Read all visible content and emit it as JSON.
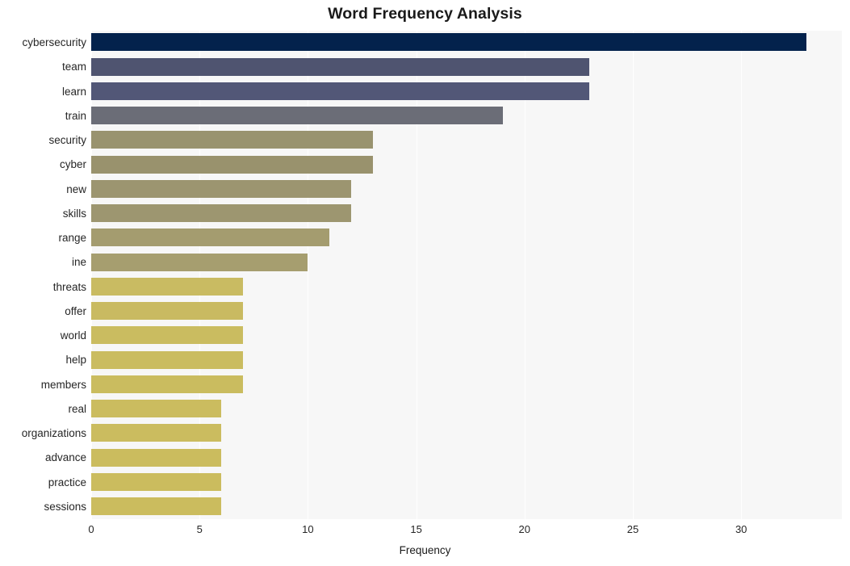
{
  "chart_data": {
    "type": "bar",
    "orientation": "horizontal",
    "title": "Word Frequency Analysis",
    "xlabel": "Frequency",
    "ylabel": "",
    "xlim": [
      0,
      34.65
    ],
    "xticks": [
      0,
      5,
      10,
      15,
      20,
      25,
      30
    ],
    "xtick_labels": [
      "0",
      "5",
      "10",
      "15",
      "20",
      "25",
      "30"
    ],
    "grid": "vertical-white",
    "legend": "none",
    "categories": [
      "cybersecurity",
      "team",
      "learn",
      "train",
      "security",
      "cyber",
      "new",
      "skills",
      "range",
      "ine",
      "threats",
      "offer",
      "world",
      "help",
      "members",
      "real",
      "organizations",
      "advance",
      "practice",
      "sessions"
    ],
    "values": [
      33,
      23,
      23,
      19,
      13,
      13,
      12,
      12,
      11,
      10,
      7,
      7,
      7,
      7,
      7,
      6,
      6,
      6,
      6,
      6
    ],
    "bar_colors": [
      "#03224c",
      "#4f5470",
      "#525777",
      "#6b6d77",
      "#99936f",
      "#99926d",
      "#9c9570",
      "#9d9670",
      "#a49c6f",
      "#a69e6f",
      "#c9bb62",
      "#c9ba61",
      "#cabc60",
      "#cabc60",
      "#cabc5f",
      "#cbbc5f",
      "#cbbc5f",
      "#cbbc5e",
      "#cbbc5e",
      "#cbbc5e"
    ],
    "plot_background": "#f7f7f7",
    "figure_background": "#ffffff",
    "gridline_color": "#ffffff"
  }
}
